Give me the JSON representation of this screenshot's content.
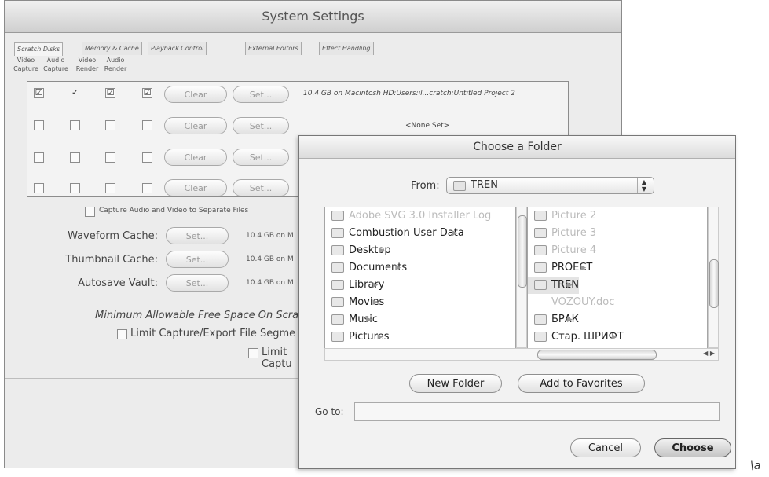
{
  "system_settings": {
    "title": "System Settings",
    "tabs": [
      "Scratch Disks",
      "Memory & Cache",
      "Playback Control",
      "External Editors",
      "Effect Handling"
    ],
    "columns": [
      {
        "top": "Video",
        "bottom": "Capture"
      },
      {
        "top": "Audio",
        "bottom": "Capture"
      },
      {
        "top": "Video",
        "bottom": "Render"
      },
      {
        "top": "Audio",
        "bottom": "Render"
      }
    ],
    "rows": [
      {
        "checks": [
          "☑",
          "✓",
          "☑",
          "☑"
        ],
        "path": "10.4 GB on  Macintosh HD:Users:il...cratch:Untitled Project 2"
      },
      {
        "checks": [
          "",
          "",
          "",
          ""
        ],
        "path": "<None Set>"
      },
      {
        "checks": [
          "",
          "",
          "",
          ""
        ],
        "path": ""
      },
      {
        "checks": [
          "",
          "",
          "",
          ""
        ],
        "path": ""
      }
    ],
    "clear_label": "Clear",
    "set_label": "Set...",
    "separate_files": "Capture Audio and Video to Separate Files",
    "waveform_label": "Waveform Cache:",
    "thumbnail_label": "Thumbnail Cache:",
    "autosave_label": "Autosave Vault:",
    "cache_value": "10.4 GB on  M",
    "min_free": "Minimum Allowable Free Space On Scra",
    "limit_segment": "Limit Capture/Export File Segme",
    "limit_capture": "Limit Captu"
  },
  "folder_dialog": {
    "title": "Choose a Folder",
    "from_label": "From:",
    "from_value": "TREN",
    "left_column": [
      {
        "name": "Adobe SVG 3.0 Installer Log",
        "dim": true
      },
      {
        "name": "Combustion User Data",
        "dim": false
      },
      {
        "name": "Desktop",
        "dim": false
      },
      {
        "name": "Documents",
        "dim": false
      },
      {
        "name": "Library",
        "dim": false
      },
      {
        "name": "Movies",
        "dim": false
      },
      {
        "name": "Music",
        "dim": false
      },
      {
        "name": "Pictures",
        "dim": false
      }
    ],
    "right_column": [
      {
        "name": "Picture 2",
        "dim": true
      },
      {
        "name": "Picture 3",
        "dim": true
      },
      {
        "name": "Picture 4",
        "dim": true
      },
      {
        "name": "PROECT",
        "dim": false
      },
      {
        "name": "TREN",
        "dim": false
      },
      {
        "name": "VOZOUY.doc",
        "dim": true
      },
      {
        "name": "БРАК",
        "dim": false
      },
      {
        "name": "Стар. ШРИФТ",
        "dim": false
      }
    ],
    "new_folder": "New Folder",
    "add_favorites": "Add to Favorites",
    "goto_label": "Go to:",
    "goto_value": "",
    "cancel": "Cancel",
    "choose": "Choose"
  },
  "corner_mark": "\\a"
}
